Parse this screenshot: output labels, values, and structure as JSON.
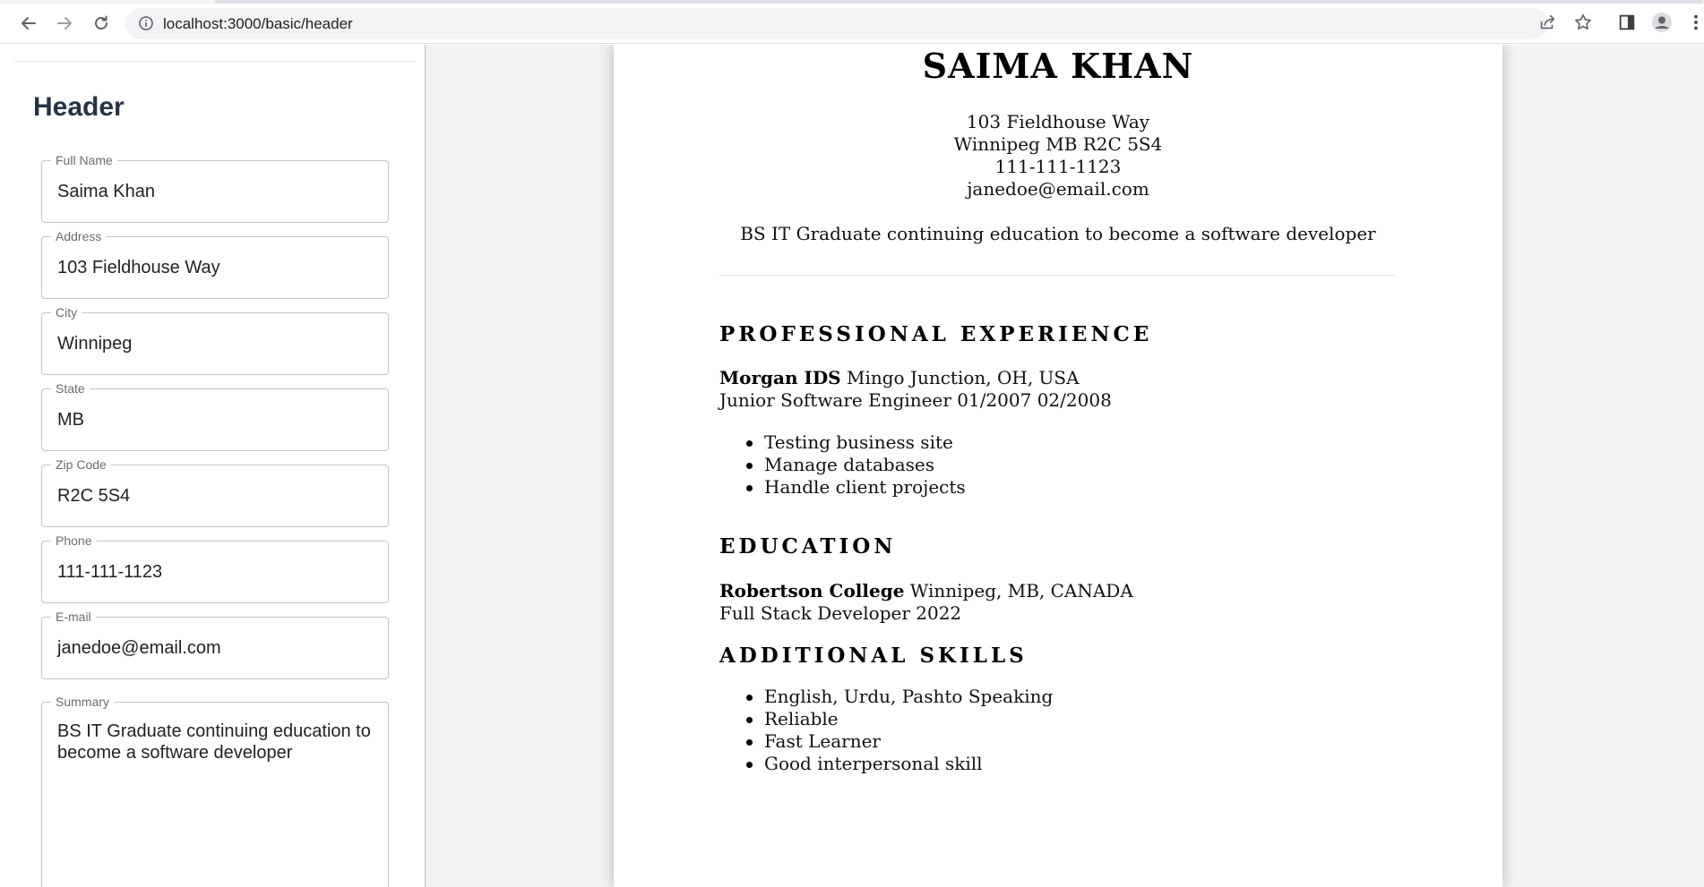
{
  "browser": {
    "url": "localhost:3000/basic/header"
  },
  "panel": {
    "title": "Header",
    "fields": [
      {
        "label": "Full Name",
        "value": "Saima Khan"
      },
      {
        "label": "Address",
        "value": "103 Fieldhouse Way"
      },
      {
        "label": "City",
        "value": "Winnipeg"
      },
      {
        "label": "State",
        "value": "MB"
      },
      {
        "label": "Zip Code",
        "value": "R2C 5S4"
      },
      {
        "label": "Phone",
        "value": "111-111-1123"
      },
      {
        "label": "E-mail",
        "value": "janedoe@email.com"
      },
      {
        "label": "Summary",
        "value": "BS IT Graduate continuing education to become a software developer"
      }
    ]
  },
  "resume": {
    "name": "SAIMA KHAN",
    "address": "103 Fieldhouse Way",
    "city_line": "Winnipeg MB R2C 5S4",
    "phone": "111-111-1123",
    "email": "janedoe@email.com",
    "summary": "BS IT Graduate continuing education to become a software developer",
    "experience": {
      "heading": "PROFESSIONAL EXPERIENCE",
      "company": "Morgan IDS",
      "location": " Mingo Junction, OH, USA",
      "role_line": "Junior Software Engineer 01/2007 02/2008",
      "bullets": [
        "Testing business site",
        "Manage databases",
        "Handle client projects"
      ]
    },
    "education": {
      "heading": "EDUCATION",
      "school": "Robertson College",
      "location": " Winnipeg, MB, CANADA",
      "program_line": "Full Stack Developer 2022"
    },
    "skills": {
      "heading": "ADDITIONAL SKILLS",
      "items": [
        "English, Urdu, Pashto Speaking",
        "Reliable",
        "Fast Learner",
        "Good interpersonal skill"
      ]
    }
  }
}
